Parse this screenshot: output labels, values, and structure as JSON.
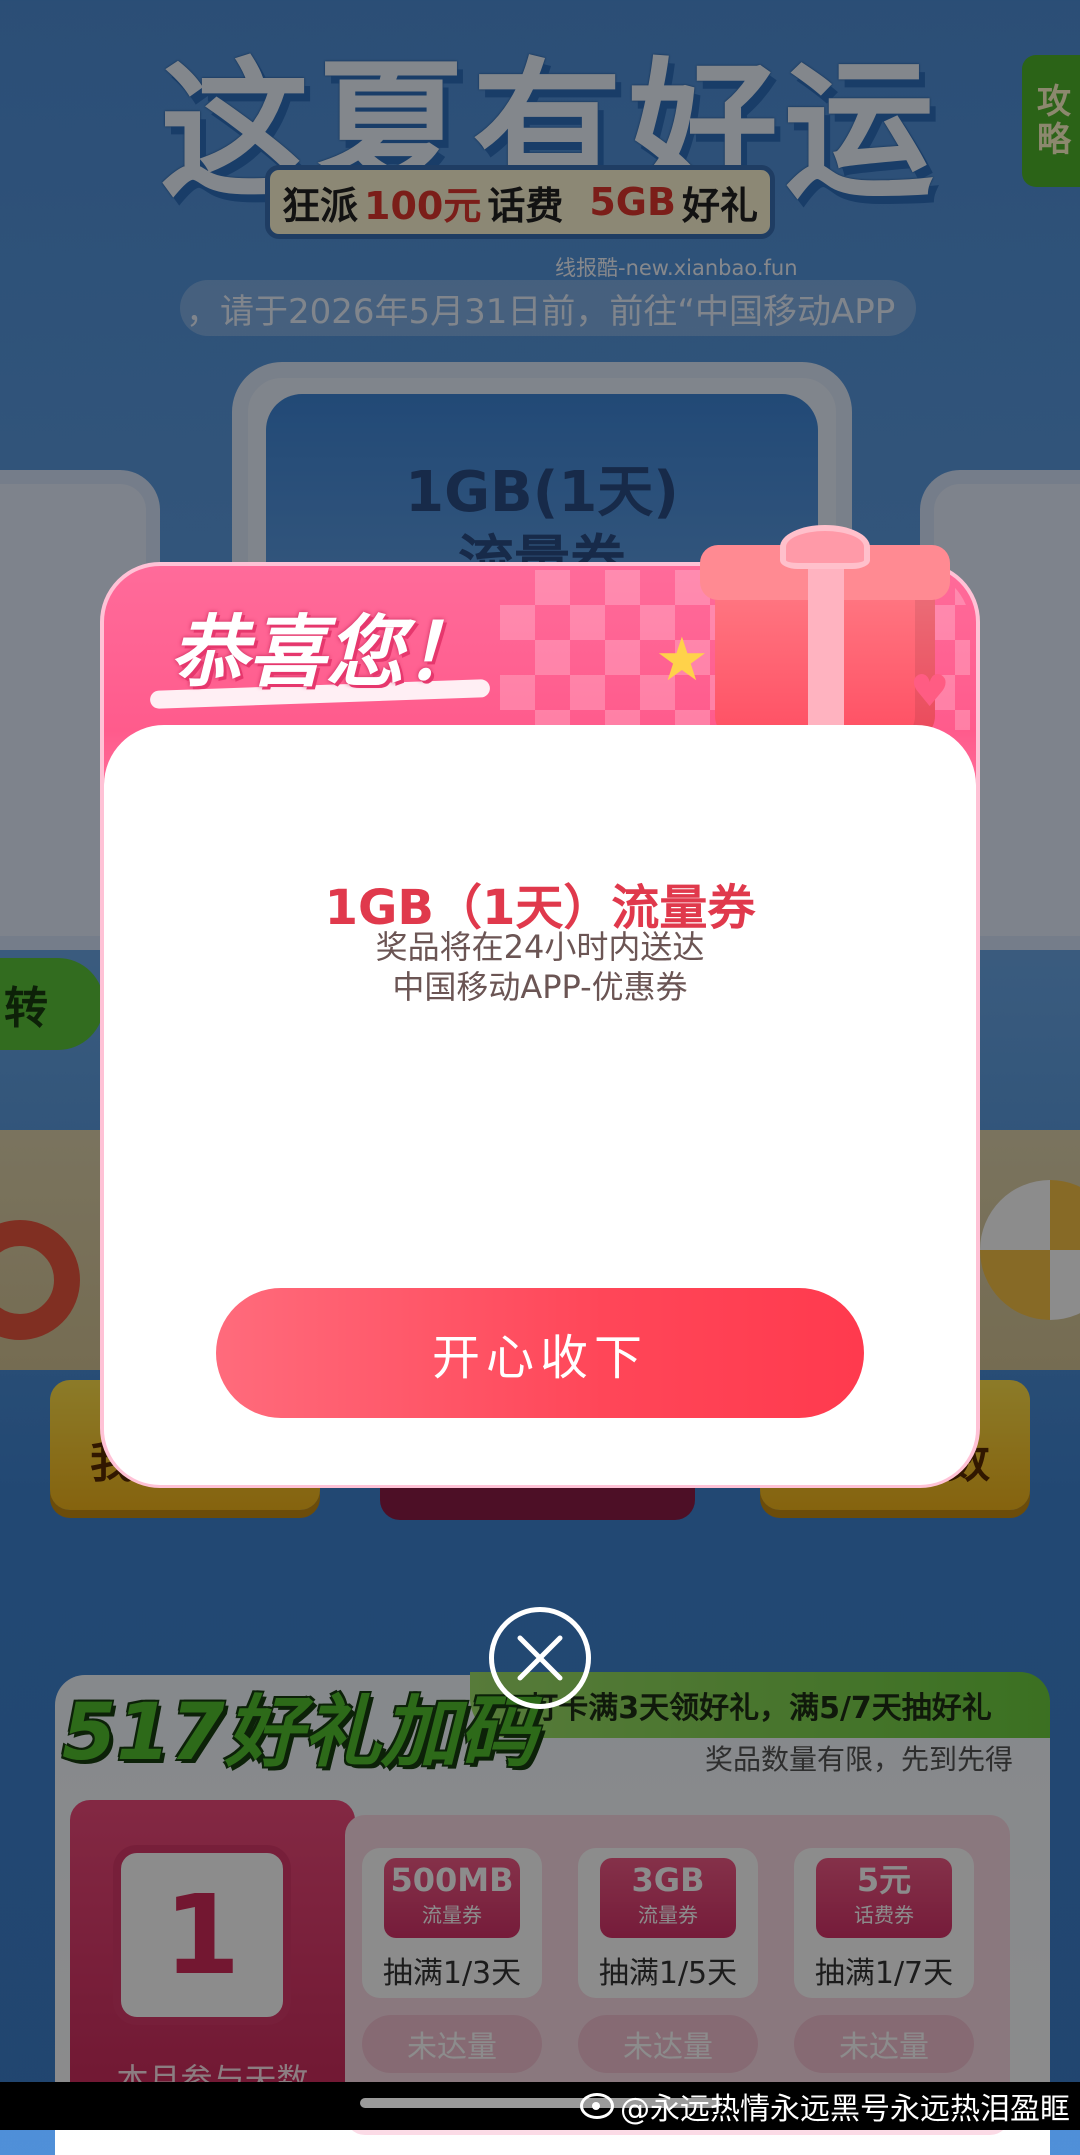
{
  "background": {
    "title": "这夏有好运",
    "subtitle_prefix": "狂派",
    "subtitle_highlight1": "100元",
    "subtitle_mid": "话费",
    "subtitle_highlight2": "5GB",
    "subtitle_suffix": "好礼",
    "strategy_tab": "攻略",
    "watermark": "线报酷-new.xianbao.fun",
    "notice": "，请于2026年5月31日前，前往“中国移动APP",
    "center_card": {
      "line1": "1GB(1天)",
      "line2": "流量券"
    },
    "left_button_partial": "转",
    "left_yellow_partial": "我",
    "right_yellow_partial": "数"
  },
  "bottom": {
    "title": "517好礼加码",
    "promo": "打卡满3天领好礼，满5/7天抽好礼",
    "limited": "奖品数量有限，先到先得",
    "counter_value": "1",
    "counter_label": "本月参与天数",
    "prizes": [
      {
        "big": "500MB",
        "small": "流量券",
        "label": "抽满1/3天",
        "status": "未达量"
      },
      {
        "big": "3GB",
        "small": "流量券",
        "label": "抽满1/5天",
        "status": "未达量"
      },
      {
        "big": "5元",
        "small": "话费券",
        "label": "抽满1/7天",
        "status": "未达量"
      }
    ]
  },
  "modal": {
    "title": "恭喜您！",
    "prize_name": "1GB（1天）流量券",
    "note_line1": "奖品将在24小时内送达",
    "note_line2": "中国移动APP-优惠券",
    "accept_button": "开心收下"
  },
  "footer": {
    "weibo_handle": "@永远热情永远黑号永远热泪盈眶"
  },
  "colors": {
    "accent_red": "#e0394c",
    "button_red": "#ff4658",
    "modal_pink": "#ff5b8c"
  }
}
